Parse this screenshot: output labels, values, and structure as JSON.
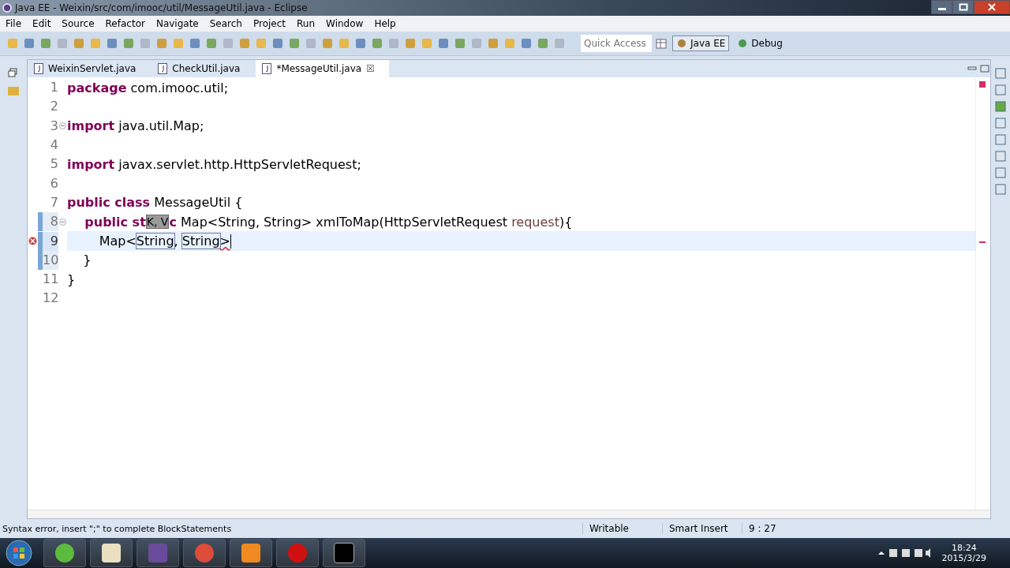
{
  "window": {
    "title": "Java EE - Weixin/src/com/imooc/util/MessageUtil.java - Eclipse"
  },
  "menu": [
    "File",
    "Edit",
    "Source",
    "Refactor",
    "Navigate",
    "Search",
    "Project",
    "Run",
    "Window",
    "Help"
  ],
  "quick_access": {
    "placeholder": "Quick Access"
  },
  "perspectives": [
    {
      "label": "Java EE",
      "selected": true
    },
    {
      "label": "Debug",
      "selected": false
    }
  ],
  "tabs": [
    {
      "label": "WeixinServlet.java",
      "selected": false
    },
    {
      "label": "CheckUtil.java",
      "selected": false
    },
    {
      "label": "*MessageUtil.java",
      "selected": true,
      "close": "☒"
    }
  ],
  "editor": {
    "lines": [
      {
        "num": "1",
        "fold": false,
        "error": false,
        "changed": false,
        "current": false,
        "tokens": [
          {
            "text": "package",
            "kind": "keyword"
          },
          {
            "text": " com.imooc.util;",
            "kind": "plain"
          }
        ]
      },
      {
        "num": "2",
        "fold": false,
        "error": false,
        "changed": false,
        "current": false
      },
      {
        "num": "3",
        "fold": true,
        "error": false,
        "changed": false,
        "current": false,
        "tokens": [
          {
            "text": "import",
            "kind": "keyword"
          },
          {
            "text": " java.util.Map;",
            "kind": "plain"
          }
        ]
      },
      {
        "num": "4",
        "fold": false,
        "error": false,
        "changed": false,
        "current": false
      },
      {
        "num": "5",
        "fold": false,
        "error": false,
        "changed": false,
        "current": false,
        "tokens": [
          {
            "text": "import",
            "kind": "keyword"
          },
          {
            "text": " javax.servlet.http.HttpServletRequest;",
            "kind": "plain"
          }
        ]
      },
      {
        "num": "6",
        "fold": false,
        "error": false,
        "changed": false,
        "current": false
      },
      {
        "num": "7",
        "fold": false,
        "error": false,
        "changed": false,
        "current": false,
        "tokens": [
          {
            "text": "public class",
            "kind": "keyword"
          },
          {
            "text": " MessageUtil {",
            "kind": "plain"
          }
        ]
      },
      {
        "num": "8",
        "fold": true,
        "error": false,
        "changed": true,
        "current": false,
        "tokens": [
          {
            "text": "    public st",
            "kind": "keyword"
          },
          {
            "text": "K, V",
            "kind": "hint"
          },
          {
            "text": "c",
            "kind": "keyword"
          },
          {
            "text": " Map<String, String> xmlToMap(HttpServletRequest ",
            "kind": "plain"
          },
          {
            "text": "request",
            "kind": "param"
          },
          {
            "text": "){",
            "kind": "plain"
          }
        ]
      },
      {
        "num": "9",
        "fold": false,
        "error": true,
        "changed": true,
        "current": true,
        "tokens": [
          {
            "text": "        Map<",
            "kind": "plain"
          },
          {
            "text": "String",
            "kind": "linked"
          },
          {
            "text": ", ",
            "kind": "plain"
          },
          {
            "text": "String",
            "kind": "linked"
          },
          {
            "text": ">",
            "kind": "squiggle"
          }
        ]
      },
      {
        "num": "10",
        "fold": false,
        "error": false,
        "changed": true,
        "current": false,
        "tokens": [
          {
            "text": "    }",
            "kind": "plain"
          }
        ]
      },
      {
        "num": "11",
        "fold": false,
        "error": false,
        "changed": false,
        "current": false,
        "tokens": [
          {
            "text": "}",
            "kind": "plain"
          }
        ]
      },
      {
        "num": "12",
        "fold": false,
        "error": false,
        "changed": false,
        "current": false
      }
    ]
  },
  "status_bar": {
    "message": "Syntax error, insert \";\" to complete BlockStatements",
    "mode": "Writable",
    "insert": "Smart Insert",
    "position": "9 : 27"
  },
  "taskbar": {
    "time": "18:24",
    "date": "2015/3/29"
  }
}
